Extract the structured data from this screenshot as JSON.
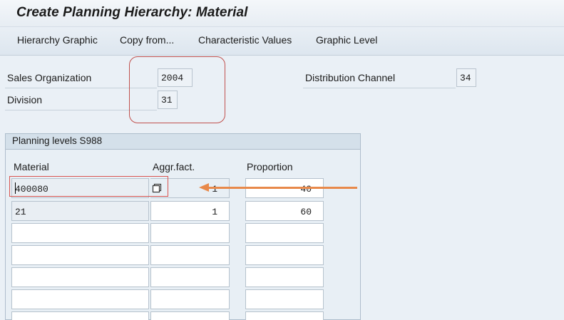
{
  "window": {
    "title": "Create Planning Hierarchy: Material"
  },
  "menu": {
    "items": [
      "Hierarchy Graphic",
      "Copy from...",
      "Characteristic Values",
      "Graphic Level"
    ]
  },
  "header_fields": {
    "sales_org": {
      "label": "Sales Organization",
      "value": "2004"
    },
    "division": {
      "label": "Division",
      "value": "31"
    },
    "dist_channel": {
      "label": "Distribution Channel",
      "value": "34"
    }
  },
  "planning_levels": {
    "title": "Planning levels S988",
    "columns": [
      "Material",
      "Aggr.fact.",
      "Proportion"
    ],
    "rows": [
      {
        "material": "400080",
        "aggr": "1",
        "proportion": "40"
      },
      {
        "material": "21",
        "aggr": "1",
        "proportion": "60"
      },
      {
        "material": "",
        "aggr": "",
        "proportion": ""
      },
      {
        "material": "",
        "aggr": "",
        "proportion": ""
      },
      {
        "material": "",
        "aggr": "",
        "proportion": ""
      },
      {
        "material": "",
        "aggr": "",
        "proportion": ""
      },
      {
        "material": "",
        "aggr": "",
        "proportion": ""
      }
    ],
    "value_help_icon": "value-help-icon"
  },
  "colors": {
    "annotation_red": "#c0504d",
    "annotation_arrow": "#e8894a",
    "panel_bg": "#e8eff5"
  }
}
